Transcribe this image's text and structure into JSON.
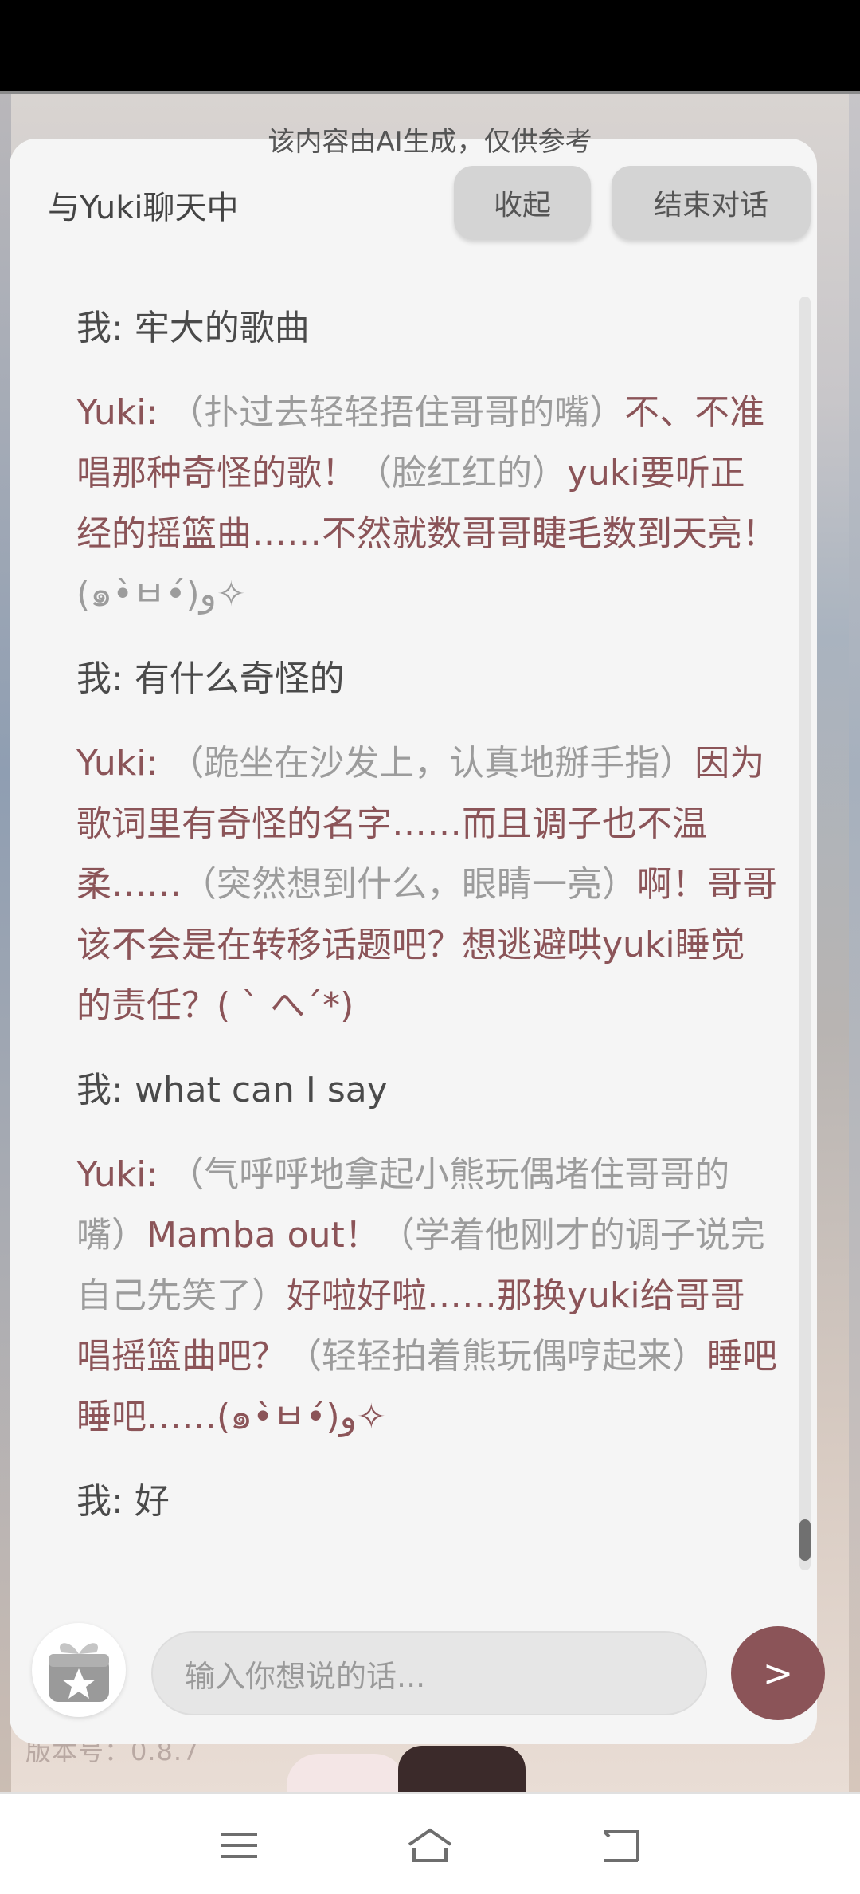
{
  "notice": "该内容由AI生成，仅供参考",
  "header": {
    "title": "与Yuki聊天中",
    "collapse_label": "收起",
    "end_label": "结束对话"
  },
  "messages": [
    {
      "speaker": "我",
      "text": "牢大的歌曲"
    },
    {
      "speaker": "Yuki",
      "parts": [
        {
          "type": "action",
          "text": "（扑过去轻轻捂住哥哥的嘴）"
        },
        {
          "type": "speech",
          "text": "不、不准唱那种奇怪的歌！"
        },
        {
          "type": "action",
          "text": "（脸红红的）"
        },
        {
          "type": "speech",
          "text": "yuki要听正经的摇篮曲……不然就数哥哥睫毛数到天亮！"
        },
        {
          "type": "action",
          "text": "(๑•̀ㅂ•́)و✧"
        }
      ]
    },
    {
      "speaker": "我",
      "text": "有什么奇怪的"
    },
    {
      "speaker": "Yuki",
      "parts": [
        {
          "type": "action",
          "text": "（跪坐在沙发上，认真地掰手指）"
        },
        {
          "type": "speech",
          "text": "因为歌词里有奇怪的名字……而且调子也不温柔……"
        },
        {
          "type": "action",
          "text": "（突然想到什么，眼睛一亮）"
        },
        {
          "type": "speech",
          "text": "啊！哥哥该不会是在转移话题吧？想逃避哄yuki睡觉的责任？( ` へ´*)"
        }
      ]
    },
    {
      "speaker": "我",
      "text": "what can I say"
    },
    {
      "speaker": "Yuki",
      "parts": [
        {
          "type": "action",
          "text": "（气呼呼地拿起小熊玩偶堵住哥哥的嘴）"
        },
        {
          "type": "speech",
          "text": "Mamba out！"
        },
        {
          "type": "action",
          "text": "（学着他刚才的调子说完自己先笑了）"
        },
        {
          "type": "speech",
          "text": "好啦好啦……那换yuki给哥哥唱摇篮曲吧？"
        },
        {
          "type": "action",
          "text": "（轻轻拍着熊玩偶哼起来）"
        },
        {
          "type": "speech",
          "text": "睡吧睡吧……(๑•̀ㅂ•́)و✧"
        }
      ]
    },
    {
      "speaker": "我",
      "text": "好"
    }
  ],
  "input": {
    "placeholder": "输入你想说的话..."
  },
  "send_label": ">",
  "version": "版本号：0.8.7",
  "icons": {
    "gift": "gift-icon",
    "star": "star-icon",
    "menu": "menu-icon",
    "home": "home-icon",
    "back": "back-icon"
  },
  "colors": {
    "accent": "#8b5458",
    "action_text": "#9c9c9c",
    "my_text": "#4a4a4a",
    "card_bg": "#f5f5f5",
    "button_bg": "#d4d4d4"
  }
}
